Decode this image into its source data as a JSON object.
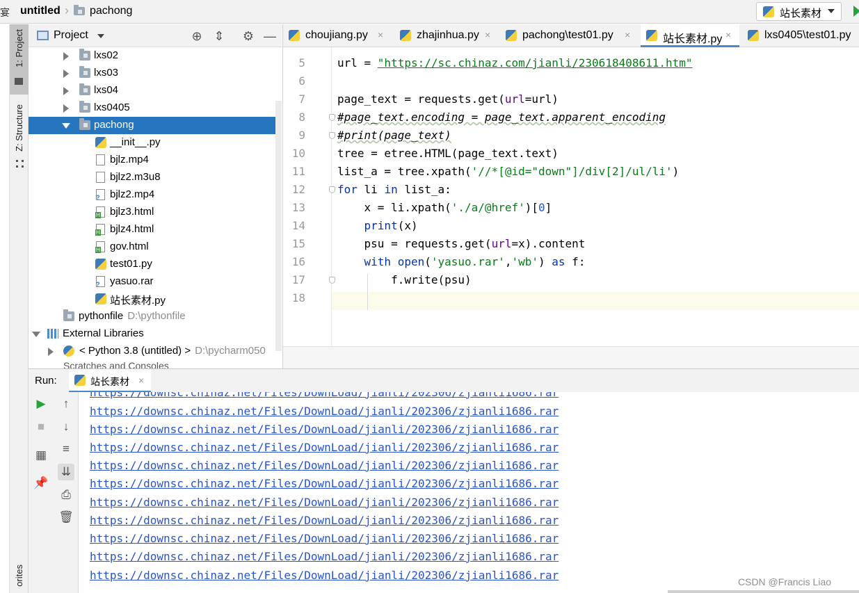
{
  "nav": {
    "edge_glyph": "宴",
    "breadcrumb": [
      "untitled",
      "pachong"
    ],
    "run_config": "站长素材"
  },
  "toolwindows": {
    "project_tab": "1: Project",
    "structure_tab": "Z: Structure",
    "favorites_tab": "orites"
  },
  "project": {
    "title": "Project",
    "tree": [
      {
        "label": "lxs02",
        "kind": "folder",
        "arrow": "right"
      },
      {
        "label": "lxs03",
        "kind": "folder",
        "arrow": "right"
      },
      {
        "label": "lxs04",
        "kind": "folder",
        "arrow": "right"
      },
      {
        "label": "lxs0405",
        "kind": "folder",
        "arrow": "right"
      },
      {
        "label": "pachong",
        "kind": "folder",
        "arrow": "down",
        "selected": true
      },
      {
        "label": "__init__.py",
        "kind": "py"
      },
      {
        "label": "bjlz.mp4",
        "kind": "file"
      },
      {
        "label": "bjlz2.m3u8",
        "kind": "file"
      },
      {
        "label": "bjlz2.mp4",
        "kind": "unknown"
      },
      {
        "label": "bjlz3.html",
        "kind": "html"
      },
      {
        "label": "bjlz4.html",
        "kind": "html"
      },
      {
        "label": "gov.html",
        "kind": "html"
      },
      {
        "label": "test01.py",
        "kind": "py"
      },
      {
        "label": "yasuo.rar",
        "kind": "unknown"
      },
      {
        "label": "站长素材.py",
        "kind": "py"
      },
      {
        "label": "pythonfile",
        "kind": "folder",
        "path": "D:\\pythonfile"
      },
      {
        "label": "External Libraries",
        "kind": "lib",
        "arrow": "down"
      },
      {
        "label": "< Python 3.8 (untitled) >",
        "kind": "python",
        "arrow": "right",
        "path": "D:\\pycharm050"
      }
    ],
    "hidden_row": "Scratches and Consoles"
  },
  "tabs": [
    {
      "label": "choujiang.py"
    },
    {
      "label": "zhajinhua.py"
    },
    {
      "label": "pachong\\test01.py"
    },
    {
      "label": "站长素材.py",
      "active": true
    },
    {
      "label": "lxs0405\\test01.py"
    }
  ],
  "editor": {
    "lines": [
      {
        "n": "5",
        "code": "url = \"https://sc.chinaz.com/jianli/230618408611.htm\""
      },
      {
        "n": "6",
        "code": ""
      },
      {
        "n": "7",
        "code": "page_text = requests.get(url=url)"
      },
      {
        "n": "8",
        "code": "#page_text.encoding = page_text.apparent_encoding"
      },
      {
        "n": "9",
        "code": "#print(page_text)"
      },
      {
        "n": "10",
        "code": "tree = etree.HTML(page_text.text)"
      },
      {
        "n": "11",
        "code": "list_a = tree.xpath('//*[@id=\"down\"]/div[2]/ul/li')"
      },
      {
        "n": "12",
        "code": "for li in list_a:"
      },
      {
        "n": "13",
        "code": "    x = li.xpath('./a/@href')[0]"
      },
      {
        "n": "14",
        "code": "    print(x)"
      },
      {
        "n": "15",
        "code": "    psu = requests.get(url=x).content"
      },
      {
        "n": "16",
        "code": "    with open('yasuo.rar','wb') as f:"
      },
      {
        "n": "17",
        "code": "        f.write(psu)"
      },
      {
        "n": "18",
        "code": ""
      }
    ]
  },
  "run": {
    "label": "Run:",
    "tab": "站长素材",
    "output_line": "https://downsc.chinaz.net/Files/DownLoad/jianli/202306/zjianli1686.rar",
    "output_count": 11
  },
  "watermark": "CSDN @Francis Liao"
}
